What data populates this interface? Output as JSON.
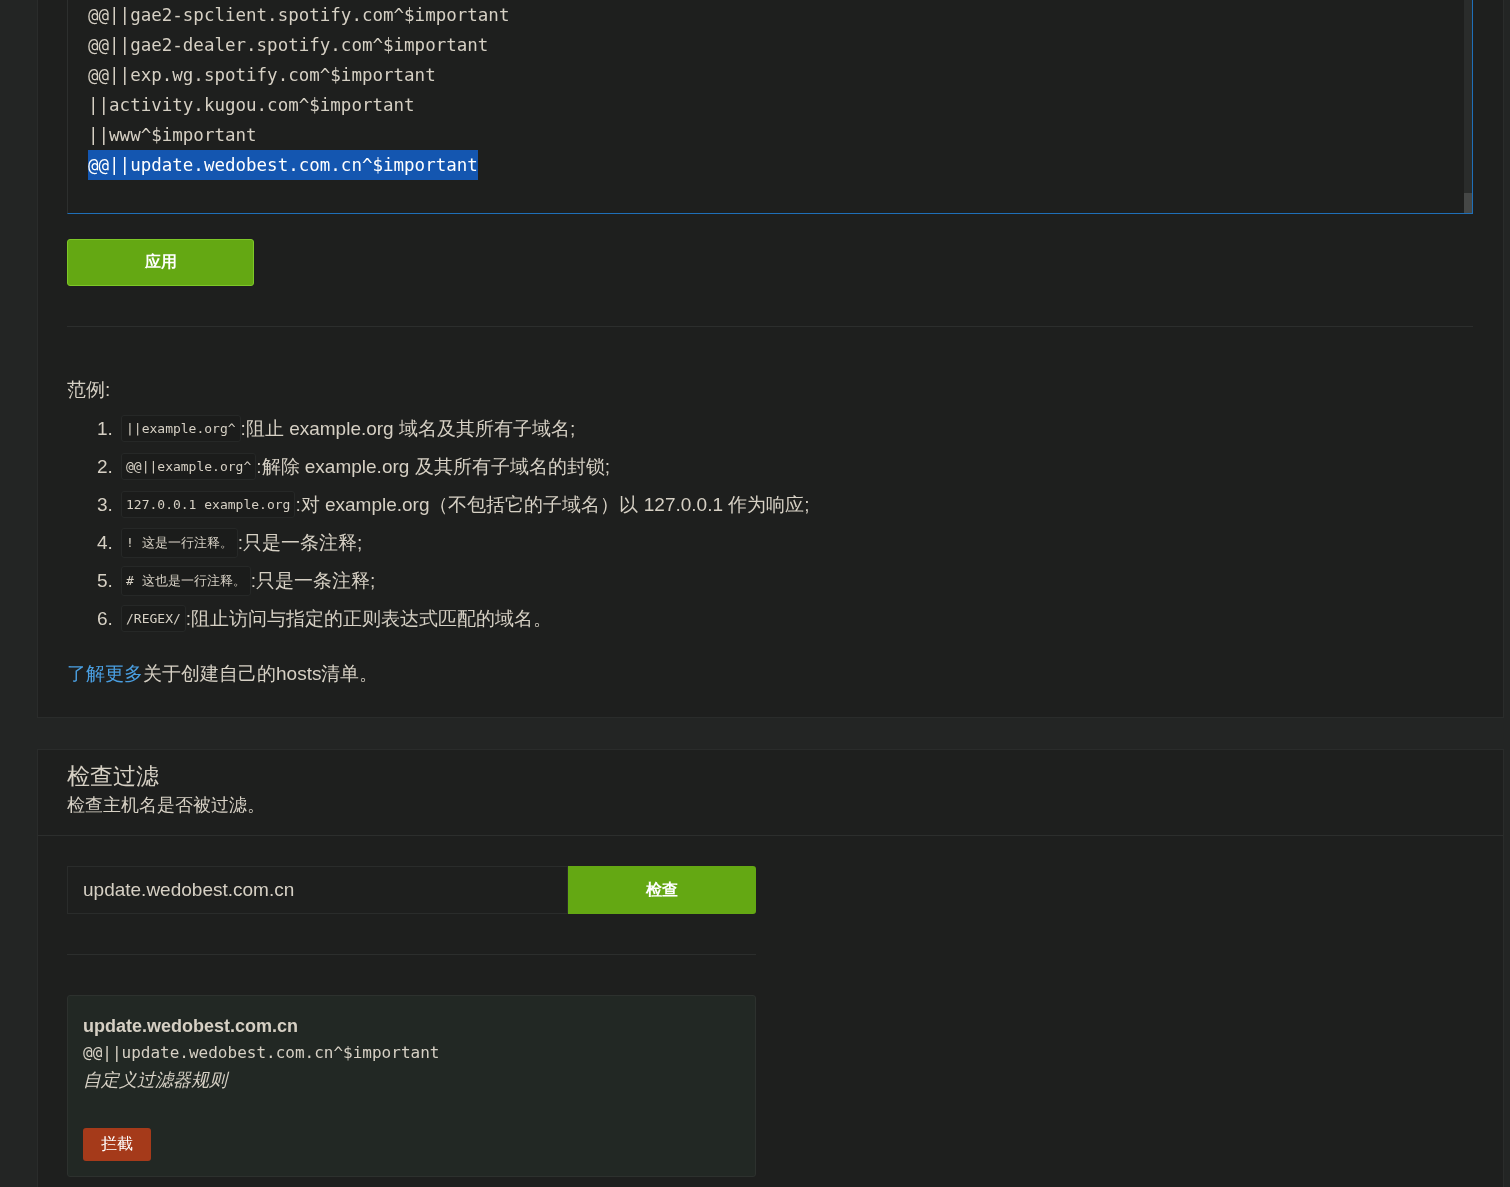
{
  "rules_editor": {
    "lines": [
      {
        "text": "@@||gae2-spclient.spotify.com^$important",
        "selected": false
      },
      {
        "text": "@@||gae2-dealer.spotify.com^$important",
        "selected": false
      },
      {
        "text": "@@||exp.wg.spotify.com^$important",
        "selected": false
      },
      {
        "text": "||activity.kugou.com^$important",
        "selected": false
      },
      {
        "text": "||www^$important",
        "selected": false
      },
      {
        "text": "@@||update.wedobest.com.cn^$important",
        "selected": true
      }
    ]
  },
  "apply_button": "应用",
  "examples": {
    "heading": "范例:",
    "items": [
      {
        "number": "1.",
        "code": "||example.org^",
        "text": ":阻止 example.org 域名及其所有子域名;"
      },
      {
        "number": "2.",
        "code": "@@||example.org^",
        "text": ":解除 example.org 及其所有子域名的封锁;"
      },
      {
        "number": "3.",
        "code": "127.0.0.1 example.org",
        "text": ":对 example.org（不包括它的子域名）以 127.0.0.1 作为响应;"
      },
      {
        "number": "4.",
        "code": "! 这是一行注释。",
        "text": ":只是一条注释;"
      },
      {
        "number": "5.",
        "code": "# 这也是一行注释。",
        "text": ":只是一条注释;"
      },
      {
        "number": "6.",
        "code": "/REGEX/",
        "text": ":阻止访问与指定的正则表达式匹配的域名。"
      }
    ]
  },
  "learn_more": {
    "link": "了解更多",
    "text": "关于创建自己的hosts清单。"
  },
  "check_filter": {
    "title": "检查过滤",
    "subtitle": "检查主机名是否被过滤。",
    "input": {
      "value": "update.wedobest.com.cn"
    },
    "button": "检查",
    "result": {
      "hostname": "update.wedobest.com.cn",
      "rule": "@@||update.wedobest.com.cn^$important",
      "source": "自定义过滤器规则",
      "badge": {
        "label": "拦截",
        "kind": "blocked"
      }
    }
  }
}
